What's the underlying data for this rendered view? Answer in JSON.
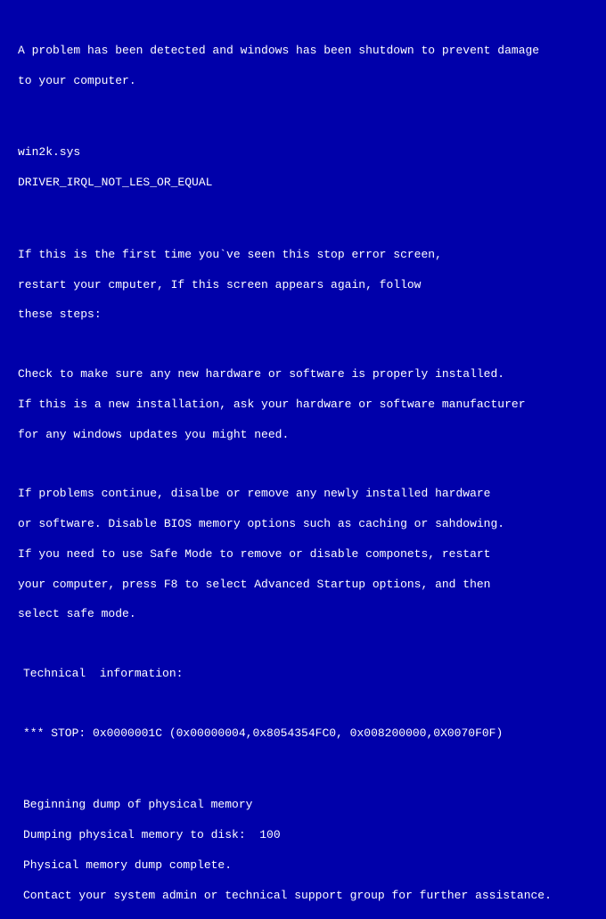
{
  "header": {
    "line1": "A problem has been detected and windows has been shutdown to prevent damage",
    "line2": "to your computer."
  },
  "fault": {
    "module": "win2k.sys",
    "error_name": "DRIVER_IRQL_NOT_LES_OR_EQUAL"
  },
  "instructions": {
    "first_time": {
      "line1": "If this is the first time you`ve seen this stop error screen,",
      "line2": "restart your cmputer, If this screen appears again, follow",
      "line3": "these steps:"
    },
    "check_hw": {
      "line1": "Check to make sure any new hardware or software is properly installed.",
      "line2": "If this is a new installation, ask your hardware or software manufacturer",
      "line3": "for any windows updates you might need."
    },
    "problems": {
      "line1": "If problems continue, disalbe or remove any newly installed hardware",
      "line2": "or software. Disable BIOS memory options such as caching or sahdowing.",
      "line3": "If you need to use Safe Mode to remove or disable componets, restart",
      "line4": "your computer, press F8 to select Advanced Startup options, and then",
      "line5": "select safe mode."
    }
  },
  "technical": {
    "heading": "Technical  information:",
    "stop_line": "*** STOP: 0x0000001C (0x00000004,0x8054354FC0, 0x008200000,0X0070F0F)"
  },
  "dump": {
    "line1": "Beginning dump of physical memory",
    "line2": "Dumping physical memory to disk:  100",
    "line3": "Physical memory dump complete.",
    "line4": "Contact your system admin or technical support group for further assistance."
  }
}
